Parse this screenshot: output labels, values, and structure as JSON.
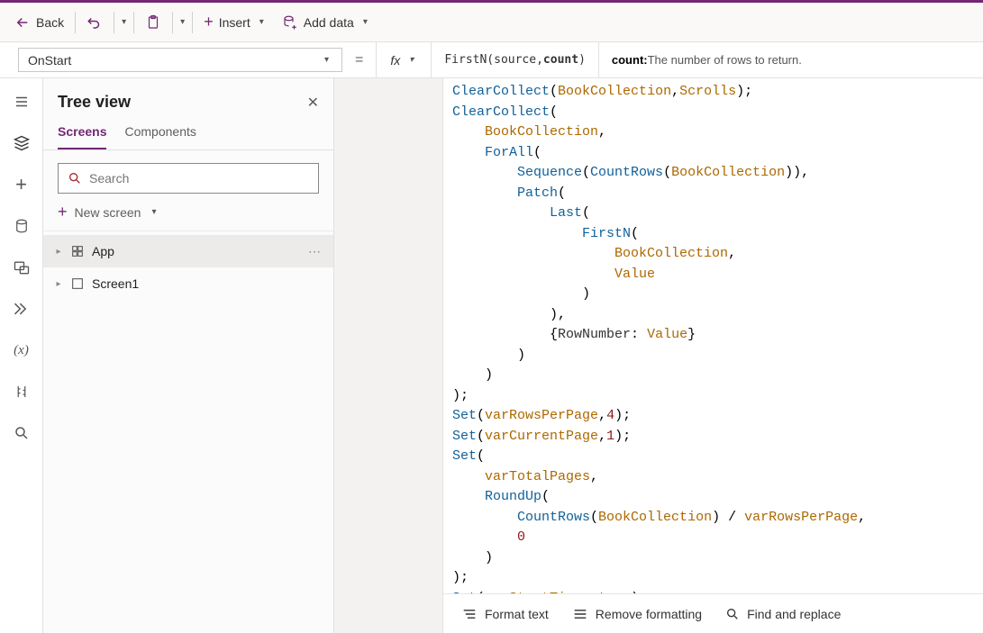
{
  "toolbar": {
    "back_label": "Back",
    "insert_label": "Insert",
    "add_data_label": "Add data"
  },
  "formula_bar": {
    "property": "OnStart",
    "fx_label": "fx",
    "equals": "="
  },
  "intellisense": {
    "signature_prefix": "FirstN(source, ",
    "signature_current": "count",
    "signature_suffix": ")",
    "desc_label": "count:",
    "desc_text": " The number of rows to return."
  },
  "side_panel": {
    "title": "Tree view",
    "tabs": {
      "screens": "Screens",
      "components": "Components"
    },
    "search_placeholder": "Search",
    "new_screen": "New screen",
    "tree": {
      "app": "App",
      "screen1": "Screen1"
    }
  },
  "formula": {
    "source": "ClearCollect(BookCollection,Scrolls);\nClearCollect(\n    BookCollection,\n    ForAll(\n        Sequence(CountRows(BookCollection)),\n        Patch(\n            Last(\n                FirstN(\n                    BookCollection,\n                    Value\n                )\n            ),\n            {RowNumber: Value}\n        )\n    )\n);\nSet(varRowsPerPage,4);\nSet(varCurrentPage,1);\nSet(\n    varTotalPages,\n    RoundUp(\n        CountRows(BookCollection) / varRowsPerPage,\n        0\n    )\n);\nSet(varStartTimer,true);"
  },
  "editor_footer": {
    "format": "Format text",
    "remove": "Remove formatting",
    "find": "Find and replace"
  }
}
